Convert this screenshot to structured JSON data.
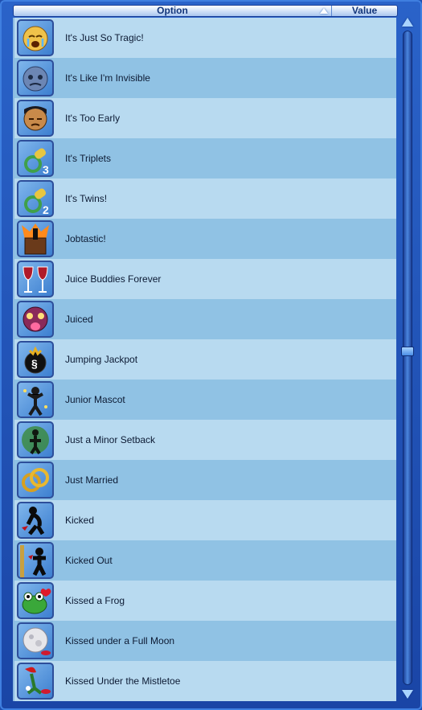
{
  "header": {
    "option_label": "Option",
    "value_label": "Value",
    "sort": "ascending"
  },
  "rows": [
    {
      "label": "It's Just So Tragic!",
      "icon": "crying-face-icon"
    },
    {
      "label": "It's Like I'm Invisible",
      "icon": "gray-face-icon"
    },
    {
      "label": "It's Too Early",
      "icon": "sleepy-face-icon"
    },
    {
      "label": "It's Triplets",
      "icon": "pacifier-3-icon",
      "badge": "3"
    },
    {
      "label": "It's Twins!",
      "icon": "pacifier-2-icon",
      "badge": "2"
    },
    {
      "label": "Jobtastic!",
      "icon": "podium-icon"
    },
    {
      "label": "Juice Buddies Forever",
      "icon": "wine-glasses-icon"
    },
    {
      "label": "Juiced",
      "icon": "tongue-face-icon"
    },
    {
      "label": "Jumping Jackpot",
      "icon": "money-bag-icon"
    },
    {
      "label": "Junior Mascot",
      "icon": "mascot-icon"
    },
    {
      "label": "Just a Minor Setback",
      "icon": "smoke-figure-icon"
    },
    {
      "label": "Just Married",
      "icon": "wedding-rings-icon"
    },
    {
      "label": "Kicked",
      "icon": "kicked-figure-icon"
    },
    {
      "label": "Kicked Out",
      "icon": "kicked-out-figure-icon"
    },
    {
      "label": "Kissed a Frog",
      "icon": "frog-icon"
    },
    {
      "label": "Kissed under a Full Moon",
      "icon": "moon-icon"
    },
    {
      "label": "Kissed Under the Mistletoe",
      "icon": "mistletoe-icon"
    }
  ],
  "colors": {
    "row_light": "#b8daf0",
    "row_dark": "#90c2e4",
    "frame": "#1f4fb0"
  }
}
